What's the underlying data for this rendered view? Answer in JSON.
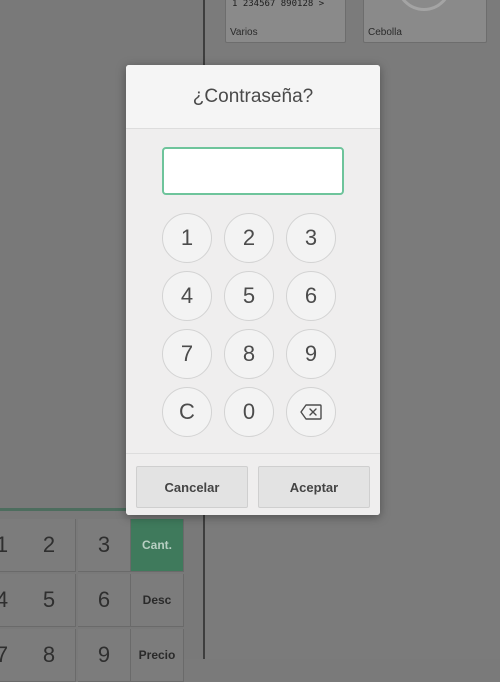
{
  "modal": {
    "title": "¿Contraseña?",
    "password_value": "",
    "keys": [
      "1",
      "2",
      "3",
      "4",
      "5",
      "6",
      "7",
      "8",
      "9",
      "C",
      "0"
    ],
    "backspace_icon": "backspace-icon",
    "cancel_label": "Cancelar",
    "accept_label": "Aceptar",
    "accent_color": "#6ec49b"
  },
  "background": {
    "products": [
      {
        "name": "Varios",
        "barcode": "1 234567 890128 >"
      },
      {
        "name": "Cebolla"
      }
    ],
    "numpad": {
      "keys": [
        "1",
        "2",
        "3",
        "4",
        "5",
        "6",
        "7",
        "8",
        "9"
      ],
      "modes": [
        "Cant.",
        "Desc",
        "Precio"
      ],
      "active_mode": "Cant."
    }
  }
}
